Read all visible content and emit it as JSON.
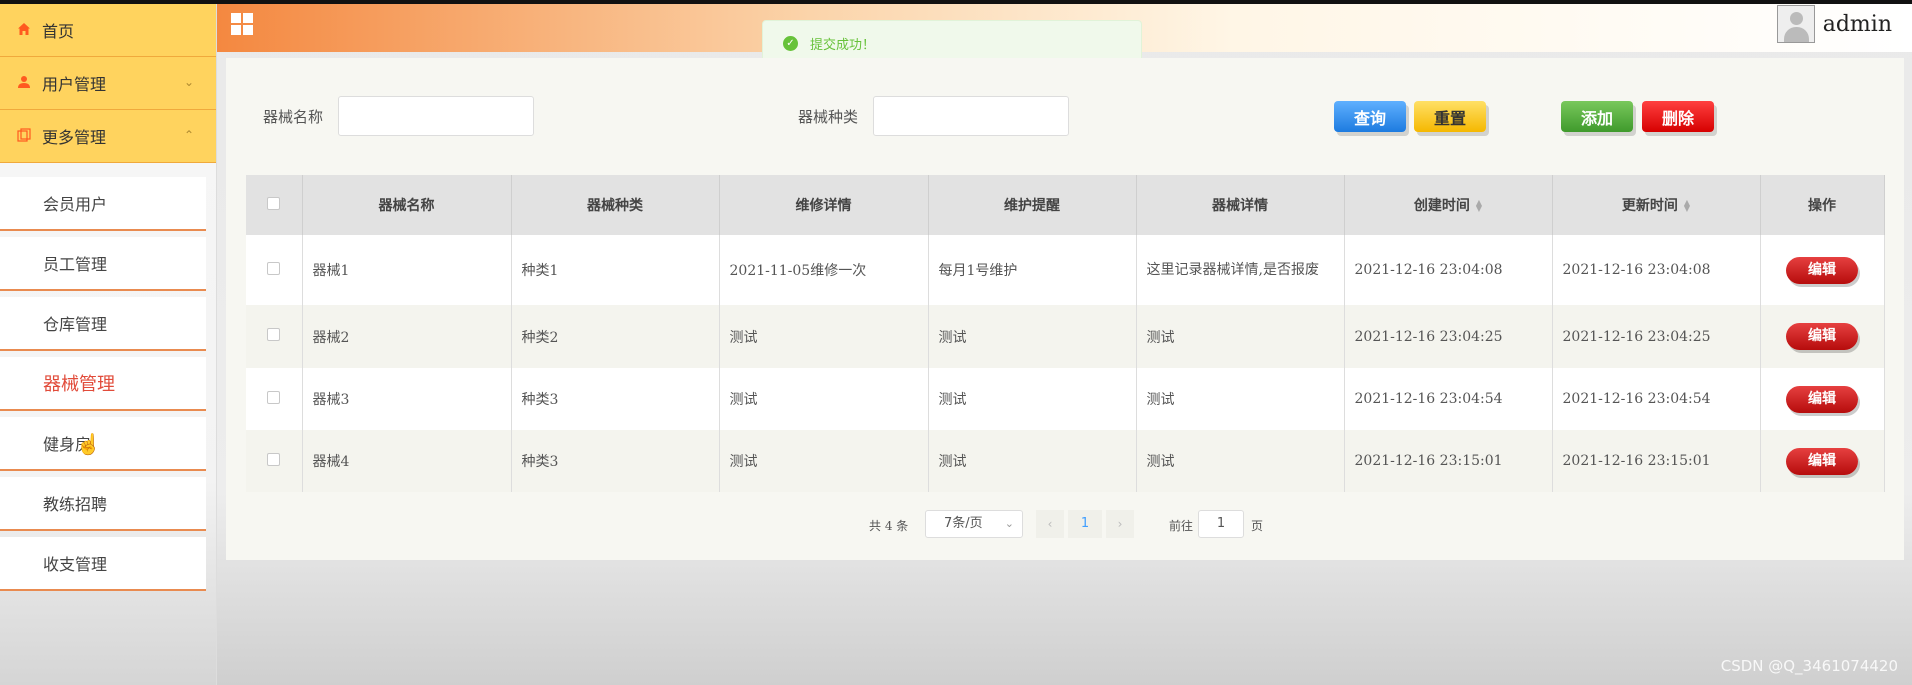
{
  "sidebar": {
    "home": {
      "label": "首页",
      "icon": "home-icon"
    },
    "user_mgmt": {
      "label": "用户管理",
      "icon": "user-icon"
    },
    "more_mgmt": {
      "label": "更多管理",
      "icon": "copy-icon"
    },
    "items": [
      {
        "label": "会员用户"
      },
      {
        "label": "员工管理"
      },
      {
        "label": "仓库管理"
      },
      {
        "label": "器械管理"
      },
      {
        "label": "健身房"
      },
      {
        "label": "教练招聘"
      },
      {
        "label": "收支管理"
      }
    ]
  },
  "header": {
    "user_name": "admin"
  },
  "toast": {
    "message": "提交成功！",
    "color": "#67c23a"
  },
  "search": {
    "name_label": "器械名称",
    "type_label": "器械种类",
    "name_value": "",
    "type_value": ""
  },
  "buttons": {
    "query": "查询",
    "reset": "重置",
    "add": "添加",
    "delete": "删除"
  },
  "table": {
    "columns": [
      "器械名称",
      "器械种类",
      "维修详情",
      "维护提醒",
      "器械详情",
      "创建时间",
      "更新时间",
      "操作"
    ],
    "rows": [
      {
        "name": "器械1",
        "type": "种类1",
        "repair": "2021-11-05维修一次",
        "maintain": "每月1号维护",
        "detail": "这里记录器械详情,是否报废",
        "created": "2021-12-16 23:04:08",
        "updated": "2021-12-16 23:04:08",
        "action": "编辑"
      },
      {
        "name": "器械2",
        "type": "种类2",
        "repair": "测试",
        "maintain": "测试",
        "detail": "测试",
        "created": "2021-12-16 23:04:25",
        "updated": "2021-12-16 23:04:25",
        "action": "编辑"
      },
      {
        "name": "器械3",
        "type": "种类3",
        "repair": "测试",
        "maintain": "测试",
        "detail": "测试",
        "created": "2021-12-16 23:04:54",
        "updated": "2021-12-16 23:04:54",
        "action": "编辑"
      },
      {
        "name": "器械4",
        "type": "种类3",
        "repair": "测试",
        "maintain": "测试",
        "detail": "测试",
        "created": "2021-12-16 23:15:01",
        "updated": "2021-12-16 23:15:01",
        "action": "编辑"
      }
    ]
  },
  "pagination": {
    "total": "共 4 条",
    "page_size": "7条/页",
    "current_page": "1",
    "goto_label": "前往",
    "goto_value": "1",
    "page_suffix": "页"
  },
  "watermark": "CSDN @Q_3461074420"
}
